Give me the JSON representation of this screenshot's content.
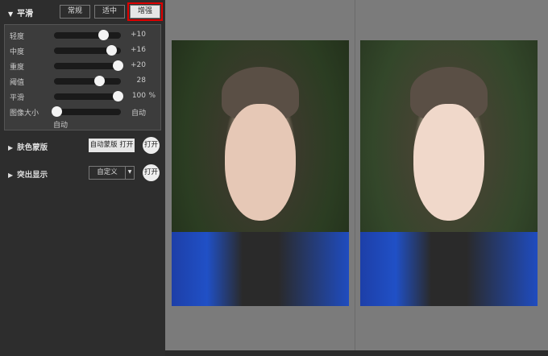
{
  "smooth": {
    "title": "平滑",
    "presets": [
      {
        "label": "常规",
        "selected": false
      },
      {
        "label": "适中",
        "selected": false
      },
      {
        "label": "增强",
        "selected": true
      }
    ],
    "sliders": [
      {
        "label": "轻度",
        "value": "+10",
        "level": 0.73,
        "unit": ""
      },
      {
        "label": "中度",
        "value": "+16",
        "level": 0.86,
        "unit": ""
      },
      {
        "label": "重度",
        "value": "+20",
        "level": 0.95,
        "unit": ""
      },
      {
        "label": "阈值",
        "value": "28",
        "level": 0.67,
        "unit": ""
      },
      {
        "label": "平滑",
        "value": "100",
        "level": 0.95,
        "unit": "%"
      },
      {
        "label": "图像大小",
        "value": "自动",
        "level": 0.04,
        "unit": ""
      }
    ],
    "image_size_sub": "自动"
  },
  "skin_mask": {
    "title": "肤色蒙版",
    "button": "自动蒙版 打开",
    "toggle": "打开"
  },
  "highlight": {
    "title": "突出显示",
    "select": "自定义",
    "toggle": "打开"
  },
  "colors": {
    "accent": "#e00000"
  }
}
